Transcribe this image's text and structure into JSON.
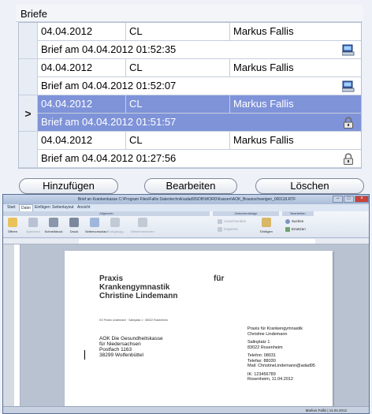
{
  "panel": {
    "title": "Briefe"
  },
  "records": [
    {
      "date": "04.04.2012",
      "initials": "CL",
      "name": "Markus Fallis",
      "subject": "Brief am 04.04.2012 01:52:35",
      "icon": "computer-icon",
      "selected": false,
      "marker": ""
    },
    {
      "date": "04.04.2012",
      "initials": "CL",
      "name": "Markus Fallis",
      "subject": "Brief am 04.04.2012 01:52:07",
      "icon": "computer-icon",
      "selected": false,
      "marker": ""
    },
    {
      "date": "04.04.2012",
      "initials": "CL",
      "name": "Markus Fallis",
      "subject": "Brief am 04.04.2012 01:51:57",
      "icon": "lock-icon",
      "selected": true,
      "marker": ">"
    },
    {
      "date": "04.04.2012",
      "initials": "CL",
      "name": "Markus Fallis",
      "subject": "Brief am 04.04.2012 01:27:56",
      "icon": "lock-icon",
      "selected": false,
      "marker": ""
    }
  ],
  "buttons": {
    "add": "Hinzufügen",
    "edit": "Bearbeiten",
    "delete": "Löschen"
  },
  "colors": {
    "selection": "#7f93d9",
    "ribbon_group": "#c8d4e6",
    "close": "#c9423a"
  },
  "word": {
    "title": "Brief an Krankenkasse C:\\Program Files\\Fallis Datentechnik\\adad95\\DB\\WORD\\Kassen\\AOK_Braunschweigen_000118.RTF",
    "tabs": [
      "Start",
      "Datei",
      "Einfügen",
      "Seitenlayout",
      "Ansicht"
    ],
    "groups": {
      "general": "Allgemein",
      "clipboard": "Zwischenablage",
      "editing": "Bearbeiten"
    },
    "tools": {
      "open": "Öffnen",
      "save": "Speichern",
      "quick_print": "Schnelldruck",
      "print": "Druck",
      "preview": "Seitenvorschau",
      "undo": "Rückgängig",
      "redo": "Wiederherstellen",
      "cut": "Ausschneiden",
      "copy": "Kopieren",
      "paste": "Einfügen",
      "search": "Suchen",
      "replace": "Ersetzen"
    },
    "doc": {
      "title_lines": [
        "Praxis",
        "Krankengymnastik",
        "Christine Lindemann"
      ],
      "title_fuer": "für",
      "sender_line": "KG Praxis Lindemann · Salinplatz 1 · 83022 Rosenheim",
      "recipient": [
        "AOK Die Gesundheitskasse",
        "für Niedersachsen",
        "Postfach 1163",
        "38299 Wolfenbüttel"
      ],
      "practice": [
        "Praxis für Krankengymnastik",
        "Christine Lindemann"
      ],
      "address": [
        "Salinplatz 1",
        "83022 Rosenheim"
      ],
      "contact": [
        "Telefon: 08031",
        "Telefax: 88030",
        "Mail: ChristineLindemann@adad95"
      ],
      "ik": "IK: 123456789",
      "place_date": "Rosenheim, 11.04.2012"
    },
    "status": {
      "user": "Markus Fallis",
      "date": "11.04.2012"
    }
  }
}
